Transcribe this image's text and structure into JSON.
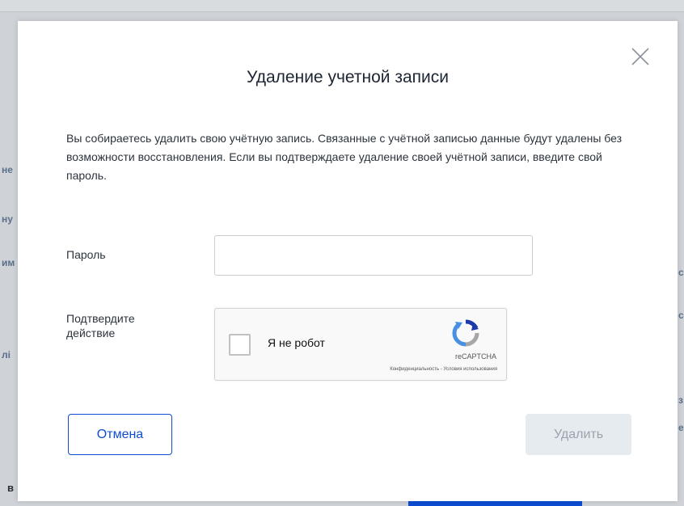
{
  "background": {
    "side_fragments": [
      "не",
      "ну",
      "им",
      "лі"
    ],
    "right_fragments": [
      "с",
      "с",
      "з",
      "е"
    ],
    "bottom_letter": "в"
  },
  "dialog": {
    "title": "Удаление учетной записи",
    "close_icon": "close-icon",
    "description": "Вы собираетесь удалить свою учётную запись. Связанные с учётной записью данные будут удалены без возможности восстановления. Если вы подтверждаете удаление своей учётной записи, введите свой пароль.",
    "password": {
      "label": "Пароль",
      "value": "",
      "placeholder": ""
    },
    "confirm": {
      "label": "Подтвердите действие",
      "captcha": {
        "checkbox_label": "Я не робот",
        "brand": "reCAPTCHA",
        "links": "Конфиденциальность - Условия использования",
        "checked": false
      }
    },
    "buttons": {
      "cancel": "Отмена",
      "delete": "Удалить",
      "delete_disabled": true
    }
  },
  "colors": {
    "accent": "#0d4cd3",
    "disabled_bg": "#e6ebef",
    "disabled_text": "#9aa3ad",
    "title_text": "#1c2533"
  }
}
